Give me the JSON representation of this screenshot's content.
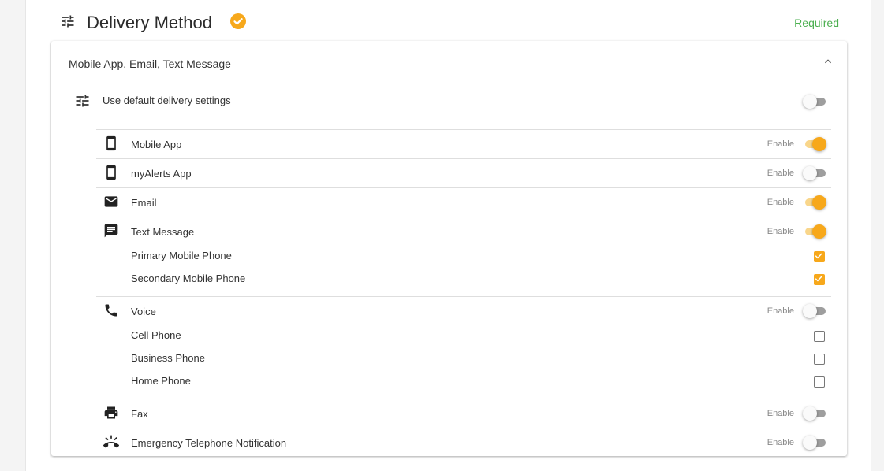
{
  "header": {
    "title": "Delivery Method",
    "status": "Required",
    "icon": "tune-icon",
    "badge_icon": "check-circle-icon",
    "accent_color": "#f7a81b",
    "status_color": "#4caf50"
  },
  "card": {
    "summary": "Mobile App, Email, Text Message",
    "collapse_icon": "chevron-up-icon",
    "default_settings": {
      "label": "Use default delivery settings",
      "enabled": false
    }
  },
  "enable_label": "Enable",
  "methods": [
    {
      "id": "mobile-app",
      "label": "Mobile App",
      "icon": "smartphone-icon",
      "enabled": true,
      "options": []
    },
    {
      "id": "myalerts-app",
      "label": "myAlerts App",
      "icon": "smartphone-icon",
      "enabled": false,
      "options": []
    },
    {
      "id": "email",
      "label": "Email",
      "icon": "email-icon",
      "enabled": true,
      "options": []
    },
    {
      "id": "text-message",
      "label": "Text Message",
      "icon": "message-icon",
      "enabled": true,
      "options": [
        {
          "label": "Primary Mobile Phone",
          "checked": true
        },
        {
          "label": "Secondary Mobile Phone",
          "checked": true
        }
      ]
    },
    {
      "id": "voice",
      "label": "Voice",
      "icon": "phone-icon",
      "enabled": false,
      "options": [
        {
          "label": "Cell Phone",
          "checked": false
        },
        {
          "label": "Business Phone",
          "checked": false
        },
        {
          "label": "Home Phone",
          "checked": false
        }
      ]
    },
    {
      "id": "fax",
      "label": "Fax",
      "icon": "printer-icon",
      "enabled": false,
      "options": []
    },
    {
      "id": "emergency-telephone",
      "label": "Emergency Telephone Notification",
      "icon": "ring-volume-icon",
      "enabled": false,
      "options": []
    }
  ]
}
